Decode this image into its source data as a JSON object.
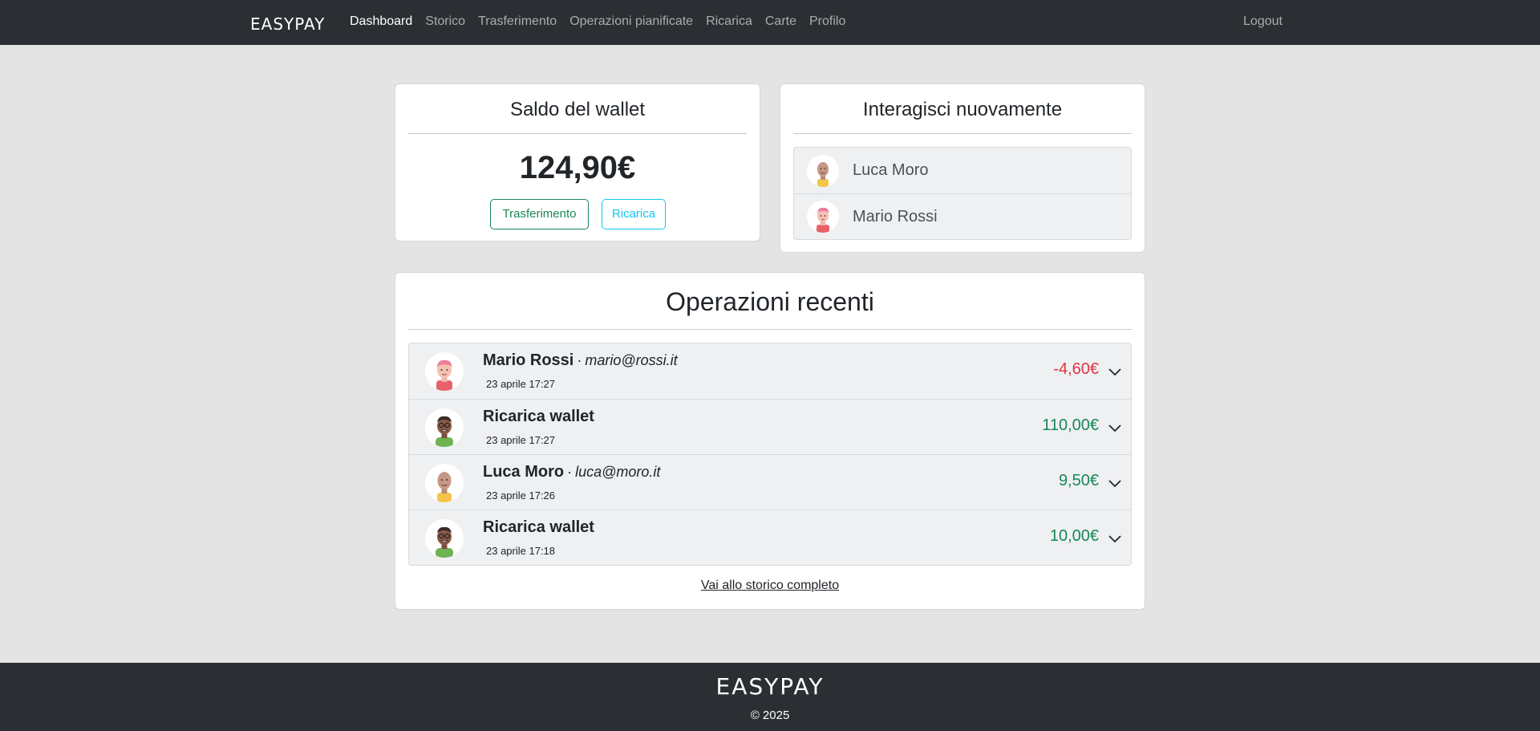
{
  "nav": {
    "brand": "EASYPAY",
    "links": [
      "Dashboard",
      "Storico",
      "Trasferimento",
      "Operazioni pianificate",
      "Ricarica",
      "Carte",
      "Profilo"
    ],
    "active": "Dashboard",
    "logout": "Logout"
  },
  "wallet": {
    "title": "Saldo del wallet",
    "balance": "124,90€",
    "transfer_label": "Trasferimento",
    "recharge_label": "Ricarica"
  },
  "interact": {
    "title": "Interagisci nuovamente",
    "contacts": [
      {
        "name": "Luca Moro",
        "avatar": "bald-man-avatar"
      },
      {
        "name": "Mario Rossi",
        "avatar": "pink-hair-avatar"
      }
    ]
  },
  "recent": {
    "title": "Operazioni recenti",
    "separator": "·",
    "operations": [
      {
        "name": "Mario Rossi",
        "email": "mario@rossi.it",
        "date": "23 aprile 17:27",
        "amount": "-4,60€",
        "sign": "neg",
        "avatar": "pink-hair-avatar"
      },
      {
        "name": "Ricarica wallet",
        "email": "",
        "date": "23 aprile 17:27",
        "amount": "110,00€",
        "sign": "pos",
        "avatar": "glasses-man-avatar"
      },
      {
        "name": "Luca Moro",
        "email": "luca@moro.it",
        "date": "23 aprile 17:26",
        "amount": "9,50€",
        "sign": "pos",
        "avatar": "bald-man-avatar"
      },
      {
        "name": "Ricarica wallet",
        "email": "",
        "date": "23 aprile 17:18",
        "amount": "10,00€",
        "sign": "pos",
        "avatar": "glasses-man-avatar"
      }
    ],
    "history_link": "Vai allo storico completo"
  },
  "footer": {
    "brand": "EASYPAY",
    "copyright": "© 2025"
  },
  "colors": {
    "navbar": "#2b2f33",
    "negative": "#dc3545",
    "positive": "#198754",
    "info": "#0dcaf0"
  }
}
